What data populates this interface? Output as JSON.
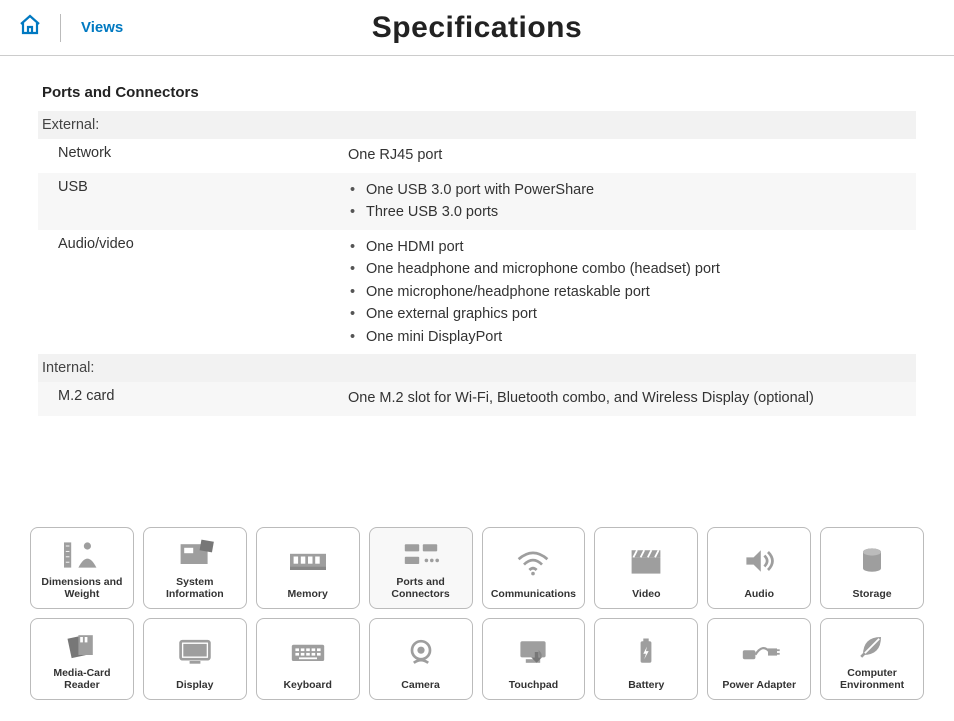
{
  "header": {
    "views_label": "Views",
    "page_title": "Specifications"
  },
  "section": {
    "title": "Ports and Connectors",
    "groups": [
      {
        "label": "External:",
        "rows": [
          {
            "label": "Network",
            "values": [
              "One RJ45 port"
            ],
            "bulleted": false
          },
          {
            "label": "USB",
            "values": [
              "One USB 3.0 port with PowerShare",
              "Three USB 3.0 ports"
            ],
            "bulleted": true
          },
          {
            "label": "Audio/video",
            "values": [
              "One HDMI port",
              "One headphone and microphone combo (headset) port",
              "One microphone/headphone retaskable port",
              "One external graphics port",
              "One mini DisplayPort"
            ],
            "bulleted": true
          }
        ]
      },
      {
        "label": "Internal:",
        "rows": [
          {
            "label": "M.2 card",
            "values": [
              "One M.2 slot for Wi-Fi, Bluetooth combo, and Wireless Display (optional)"
            ],
            "bulleted": false
          }
        ]
      }
    ]
  },
  "tiles": [
    [
      {
        "id": "dimensions",
        "label": "Dimensions and\nWeight",
        "icon": "ruler-weight"
      },
      {
        "id": "sysinfo",
        "label": "System\nInformation",
        "icon": "chip"
      },
      {
        "id": "memory",
        "label": "Memory",
        "icon": "ram"
      },
      {
        "id": "ports",
        "label": "Ports and\nConnectors",
        "icon": "ports",
        "active": true
      },
      {
        "id": "comm",
        "label": "Communications",
        "icon": "wifi"
      },
      {
        "id": "video",
        "label": "Video",
        "icon": "clapper"
      },
      {
        "id": "audio",
        "label": "Audio",
        "icon": "speaker"
      },
      {
        "id": "storage",
        "label": "Storage",
        "icon": "cylinder"
      }
    ],
    [
      {
        "id": "mediacard",
        "label": "Media-Card\nReader",
        "icon": "cards"
      },
      {
        "id": "display",
        "label": "Display",
        "icon": "monitor"
      },
      {
        "id": "keyboard",
        "label": "Keyboard",
        "icon": "keyboard"
      },
      {
        "id": "camera",
        "label": "Camera",
        "icon": "webcam"
      },
      {
        "id": "touchpad",
        "label": "Touchpad",
        "icon": "touchpad"
      },
      {
        "id": "battery",
        "label": "Battery",
        "icon": "battery"
      },
      {
        "id": "adapter",
        "label": "Power Adapter",
        "icon": "adapter"
      },
      {
        "id": "env",
        "label": "Computer\nEnvironment",
        "icon": "leaf"
      }
    ]
  ]
}
